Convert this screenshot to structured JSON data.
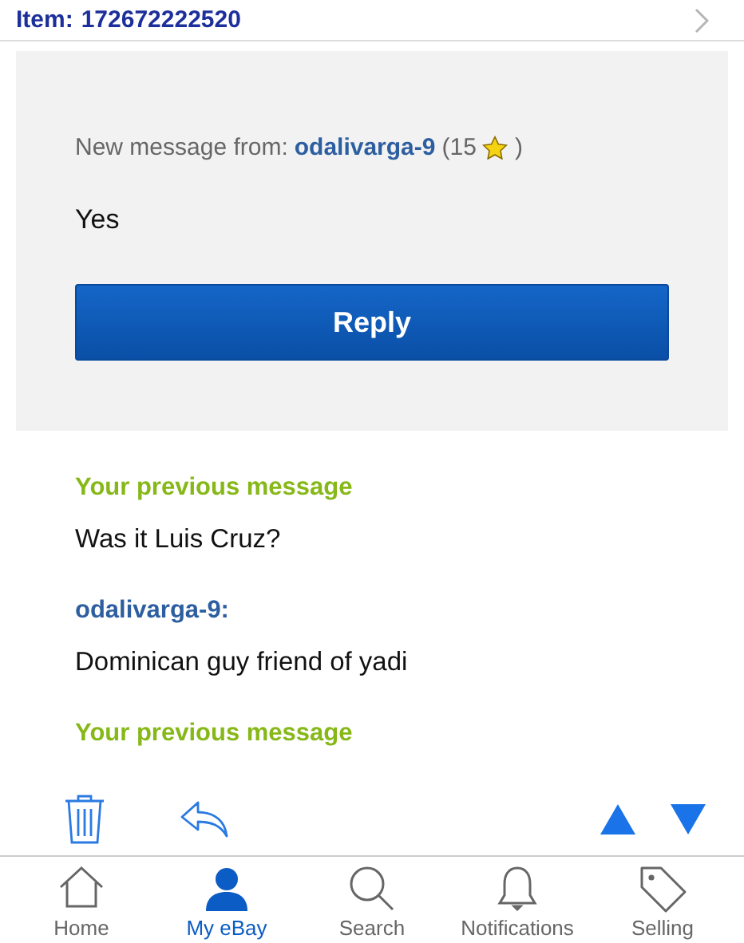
{
  "header": {
    "item_label": "Item:",
    "item_number": "172672222520"
  },
  "message": {
    "intro": "New message from:",
    "sender": "odalivarga-9",
    "feedback_open": "(15",
    "feedback_close": ")",
    "body": "Yes",
    "reply_button": "Reply"
  },
  "history": [
    {
      "kind": "mine",
      "heading": "Your previous message",
      "text": "Was it Luis Cruz?"
    },
    {
      "kind": "other",
      "heading": "odalivarga-9:",
      "text": "Dominican guy friend of yadi"
    },
    {
      "kind": "mine",
      "heading": "Your previous message"
    }
  ],
  "tabs": [
    {
      "kind": "home",
      "label": "Home",
      "selected": false
    },
    {
      "kind": "profile",
      "label": "My eBay",
      "selected": true
    },
    {
      "kind": "search",
      "label": "Search",
      "selected": false
    },
    {
      "kind": "bell",
      "label": "Notifications",
      "selected": false
    },
    {
      "kind": "tag",
      "label": "Selling",
      "selected": false
    }
  ]
}
